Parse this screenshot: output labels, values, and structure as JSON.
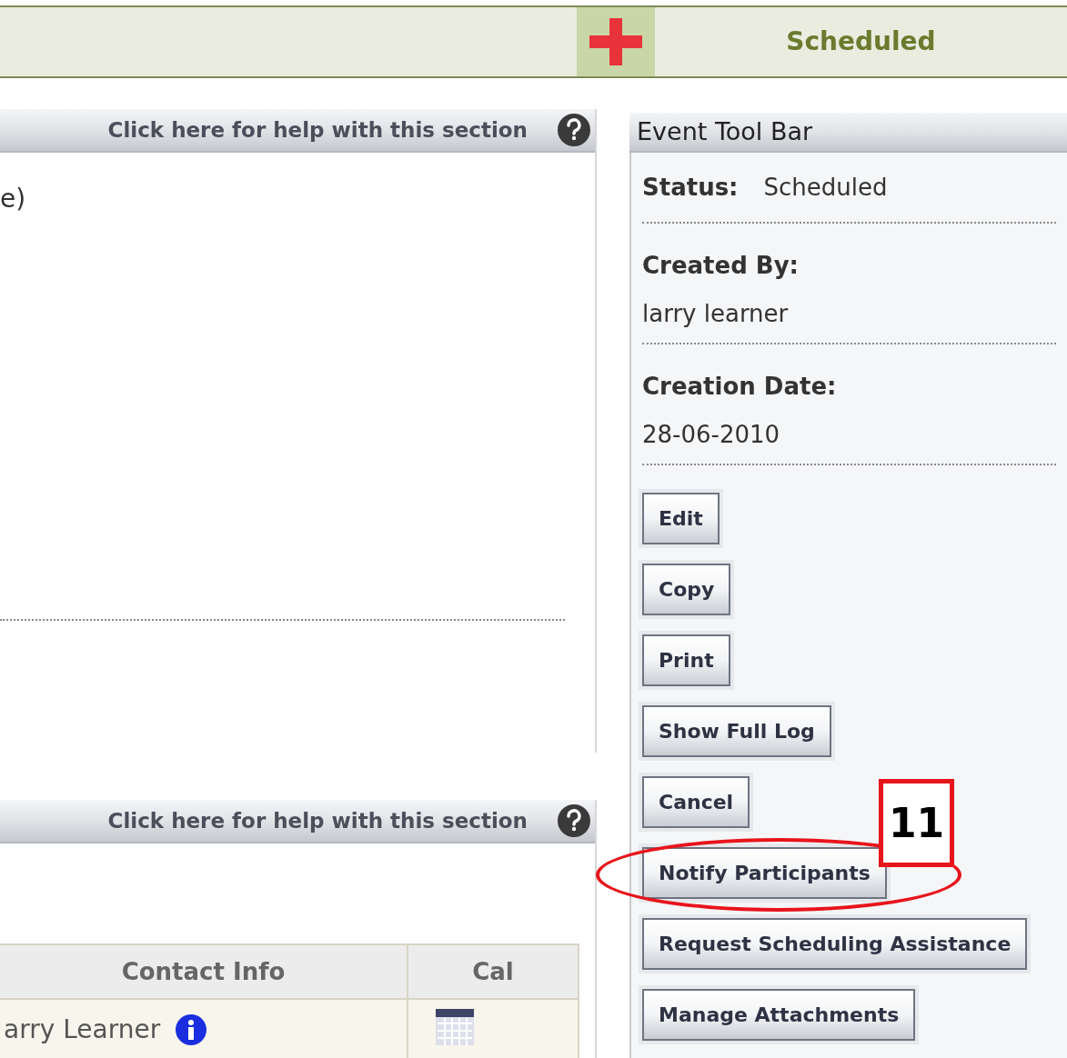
{
  "top_bar": {
    "status": "Scheduled"
  },
  "sections": [
    {
      "help_link": "Click here for help with this section",
      "text": "e)"
    },
    {
      "help_link": "Click here for help with this section",
      "table": {
        "columns": [
          "Contact Info",
          "Cal"
        ],
        "rows": [
          {
            "contact_info": "arry Learner"
          }
        ]
      }
    }
  ],
  "event_toolbar": {
    "title": "Event Tool Bar",
    "status_label": "Status:",
    "status": "Scheduled",
    "fields": [
      {
        "label": "Created By:",
        "value": "larry learner"
      },
      {
        "label": "Creation Date:",
        "value": "28-06-2010"
      }
    ],
    "buttons": [
      "Edit",
      "Copy",
      "Print",
      "Show Full Log",
      "Cancel",
      "Notify Participants",
      "Request Scheduling Assistance",
      "Manage Attachments"
    ]
  },
  "annotation": {
    "number": "11"
  }
}
